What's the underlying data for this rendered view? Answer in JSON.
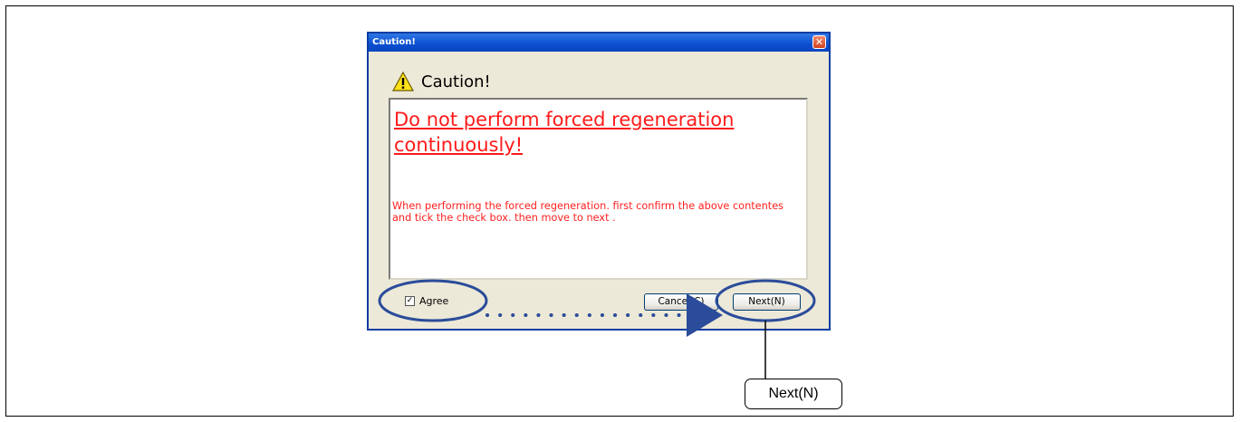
{
  "dialog": {
    "title": "Caution!",
    "close_glyph": "✕",
    "heading": "Caution!",
    "heading_icon": "warning-icon",
    "message_title": "Do not perform forced regeneration continuously!",
    "message_body": "When performing the forced regeneration. first confirm the above contentes and tick the check box. then move to next .",
    "agree_label": "Agree",
    "agree_checked": true,
    "agree_mark": "✓",
    "cancel_label": "Cancel(C)",
    "next_label": "Next(N)"
  },
  "callout": {
    "label": "Next(N)"
  },
  "colors": {
    "titlebar": "#0a4fd0",
    "warning_text": "#ff1a1a",
    "annotation": "#2b4c9a",
    "dialog_bg": "#ece9d8"
  }
}
